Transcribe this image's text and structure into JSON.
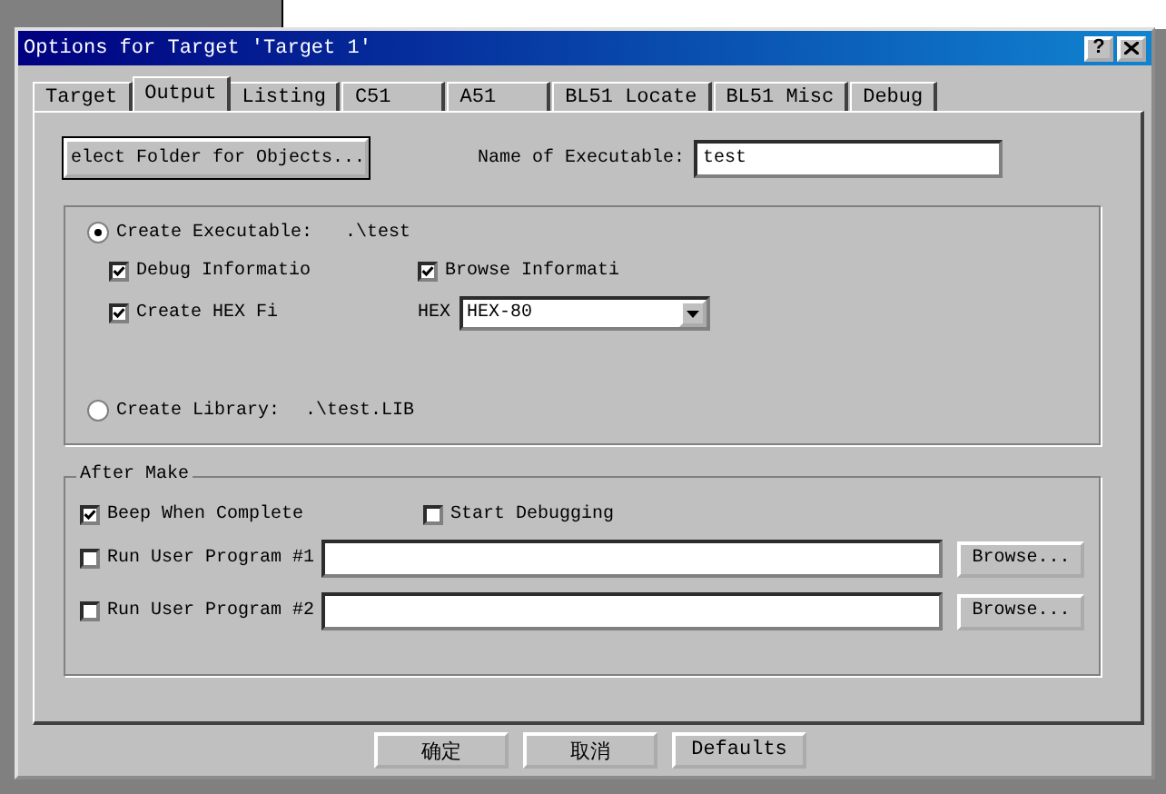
{
  "window": {
    "title": "Options for Target 'Target 1'",
    "help_button": "?"
  },
  "tabs": [
    {
      "label": "Target",
      "selected": false
    },
    {
      "label": "Output",
      "selected": true
    },
    {
      "label": "Listing",
      "selected": false
    },
    {
      "label": "C51",
      "selected": false
    },
    {
      "label": "A51",
      "selected": false
    },
    {
      "label": "BL51 Locate",
      "selected": false
    },
    {
      "label": "BL51 Misc",
      "selected": false
    },
    {
      "label": "Debug",
      "selected": false
    }
  ],
  "select_folder_button": "elect Folder for Objects...",
  "name_of_executable": {
    "label": "Name of Executable:",
    "value": "test"
  },
  "create_executable": {
    "label": "Create Executable:",
    "path": ".\\test",
    "selected": true
  },
  "executable_options": [
    {
      "label": "Debug Informatio",
      "checked": true
    },
    {
      "label": "Browse Informati",
      "checked": true
    },
    {
      "label": "Create HEX Fi",
      "checked": true
    }
  ],
  "hex_format": {
    "label": "HEX",
    "value": "HEX-80"
  },
  "create_library": {
    "label": "Create Library:",
    "path": ".\\test.LIB",
    "selected": false
  },
  "after_make": {
    "title": "After Make",
    "options": [
      {
        "label": "Beep When Complete",
        "checked": true
      },
      {
        "label": "Start Debugging",
        "checked": false
      }
    ],
    "user_programs": [
      {
        "label": "Run User Program #1",
        "checked": false,
        "browse": "Browse..."
      },
      {
        "label": "Run User Program #2",
        "checked": false,
        "browse": "Browse..."
      }
    ]
  },
  "buttons": [
    "确定",
    "取消",
    "Defaults"
  ]
}
